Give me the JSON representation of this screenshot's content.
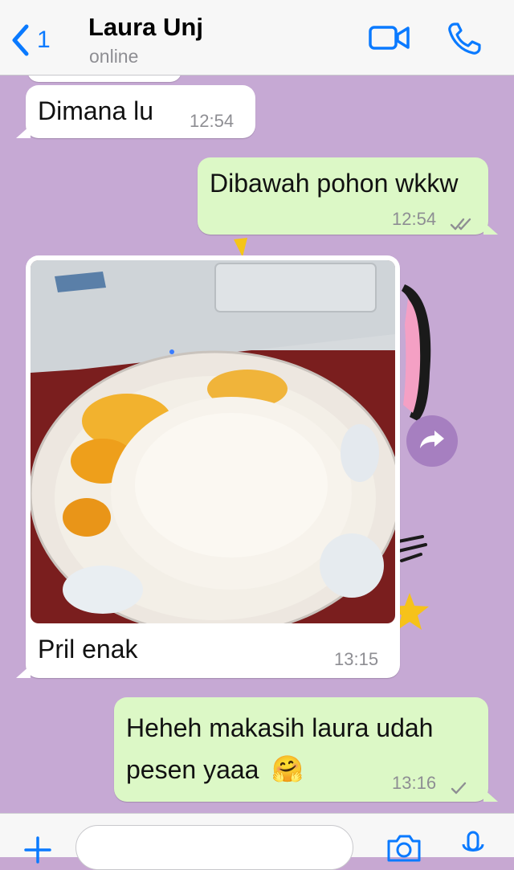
{
  "header": {
    "back_count": "1",
    "contact_name": "Laura Unj",
    "contact_status": "online"
  },
  "messages": [
    {
      "direction": "in",
      "text": "Dimana lu",
      "time": "12:54"
    },
    {
      "direction": "out",
      "text": "Dibawah pohon wkkw",
      "time": "12:54",
      "status": "read"
    },
    {
      "direction": "in",
      "type": "image",
      "caption": "Pril enak",
      "time": "13:15"
    },
    {
      "direction": "out",
      "text_line1": "Heheh makasih laura udah",
      "text_line2": "pesen yaaa",
      "emoji": "🤗",
      "time": "13:16",
      "status": "sent"
    }
  ],
  "icons": {
    "back": "chevron-left-icon",
    "video": "video-camera-icon",
    "phone": "phone-icon",
    "forward": "forward-arrow-icon",
    "add": "plus-icon",
    "camera": "camera-icon",
    "mic": "microphone-icon"
  },
  "colors": {
    "accent": "#0a7aff",
    "outgoing_bubble": "#dcf8c6",
    "incoming_bubble": "#ffffff",
    "chat_background": "#c6a9d4"
  }
}
